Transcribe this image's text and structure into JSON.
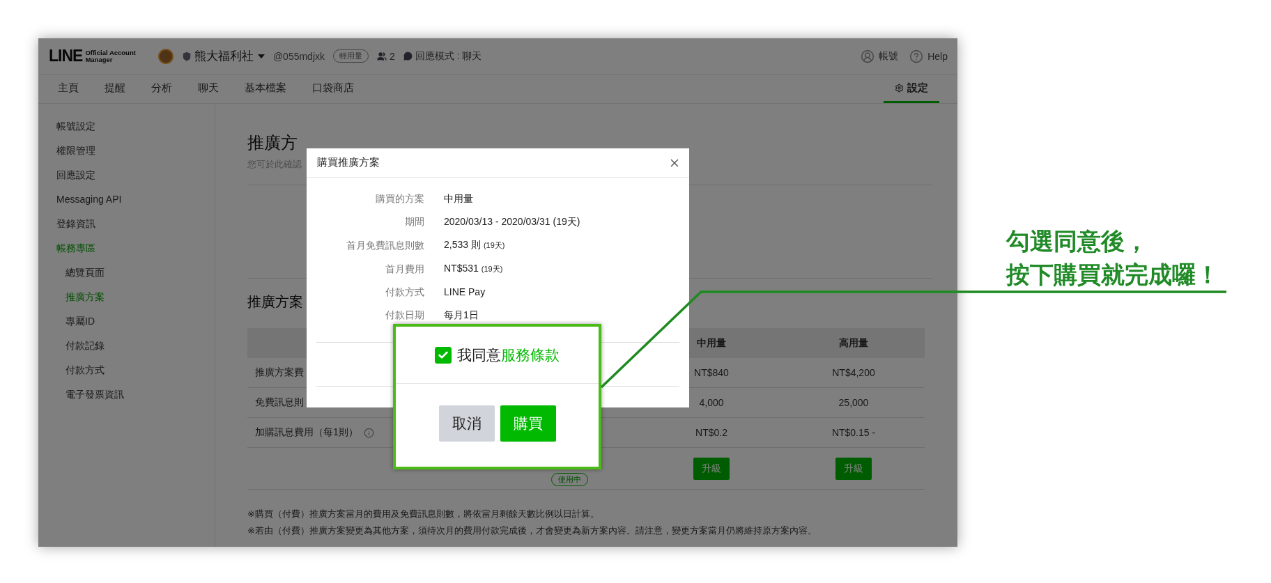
{
  "header": {
    "brand": "LINE",
    "product_lines": [
      "Official Account",
      "Manager"
    ],
    "account_name": "熊大福利社",
    "account_id": "@055mdjxk",
    "plan_badge": "輕用量",
    "members": "2",
    "response_mode": "回應模式 : 聊天",
    "account_link": "帳號",
    "help_link": "Help"
  },
  "nav_tabs": [
    {
      "label": "主頁",
      "selected": false
    },
    {
      "label": "提醒",
      "selected": false
    },
    {
      "label": "分析",
      "selected": false
    },
    {
      "label": "聊天",
      "selected": false
    },
    {
      "label": "基本檔案",
      "selected": false
    },
    {
      "label": "口袋商店",
      "selected": false
    }
  ],
  "settings_tab": {
    "label": "設定",
    "selected": true
  },
  "sidebar": {
    "items": [
      {
        "label": "帳號設定",
        "selected": false
      },
      {
        "label": "權限管理",
        "selected": false
      },
      {
        "label": "回應設定",
        "selected": false
      },
      {
        "label": "Messaging API",
        "selected": false
      },
      {
        "label": "登錄資訊",
        "selected": false
      },
      {
        "label": "帳務專區",
        "selected": true,
        "children": [
          {
            "label": "總覽頁面",
            "selected": false
          },
          {
            "label": "推廣方案",
            "selected": true
          },
          {
            "label": "專屬ID",
            "selected": false
          },
          {
            "label": "付款記錄",
            "selected": false
          },
          {
            "label": "付款方式",
            "selected": false
          },
          {
            "label": "電子發票資訊",
            "selected": false
          }
        ]
      }
    ]
  },
  "content": {
    "title": "推廣方",
    "subtitle": "您可於此確認",
    "section_title": "推廣方案",
    "table": {
      "visible_columns": [
        "中用量",
        "高用量"
      ],
      "rows": [
        {
          "label": "推廣方案費",
          "info": false,
          "values": [
            "NT$840",
            "NT$4,200"
          ]
        },
        {
          "label": "免費訊息則",
          "info": false,
          "values": [
            "4,000",
            "25,000"
          ]
        },
        {
          "label": "加購訊息費用（每1則）",
          "info": true,
          "values": [
            "NT$0.2",
            "NT$0.15 -"
          ]
        }
      ],
      "current_badge": "使用中",
      "upgrade_buttons": [
        "升級",
        "升級"
      ]
    },
    "notes": [
      "※購買（付費）推廣方案當月的費用及免費訊息則數，將依當月剩餘天數比例以日計算。",
      "※若由（付費）推廣方案變更為其他方案，須待次月的費用付款完成後，才會變更為新方案內容。請注意，變更方案當月仍將維持原方案內容。"
    ]
  },
  "dialog": {
    "title": "購買推廣方案",
    "rows": [
      {
        "label": "購買的方案",
        "value": "中用量"
      },
      {
        "label": "期間",
        "value": "2020/03/13 - 2020/03/31 (19天)"
      },
      {
        "label": "首月免費訊息則數",
        "value": "2,533 則",
        "note": "(19天)"
      },
      {
        "label": "首月費用",
        "value": "NT$531",
        "note": "(19天)"
      },
      {
        "label": "付款方式",
        "value": "LINE Pay"
      },
      {
        "label": "付款日期",
        "value": "每月1日"
      }
    ]
  },
  "callout": {
    "agree_checked": true,
    "agree_text": "我同意",
    "terms_link": "服務條款",
    "buttons": [
      {
        "label": "取消",
        "kind": "secondary"
      },
      {
        "label": "購買",
        "kind": "primary"
      }
    ]
  },
  "annotation": {
    "lines": [
      "勾選同意後，",
      "按下購買就完成囉！"
    ]
  }
}
